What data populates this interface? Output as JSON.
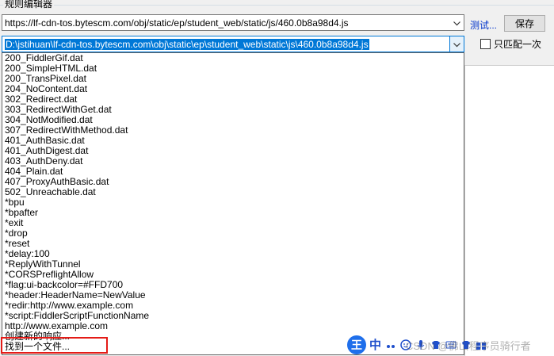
{
  "editor": {
    "group_title": "规则编辑器",
    "url_value": "https://lf-cdn-tos.bytescm.com/obj/static/ep/student_web/static/js/460.0b8a98d4.js",
    "response_value": "D:\\jstihuan\\lf-cdn-tos.bytescm.com\\obj\\static\\ep\\student_web\\static\\js\\460.0b8a98d4.js",
    "test_label": "测试...",
    "save_label": "保存",
    "match_once_label": "只匹配一次"
  },
  "dropdown_items": [
    "200_FiddlerGif.dat",
    "200_SimpleHTML.dat",
    "200_TransPixel.dat",
    "204_NoContent.dat",
    "302_Redirect.dat",
    "303_RedirectWithGet.dat",
    "304_NotModified.dat",
    "307_RedirectWithMethod.dat",
    "401_AuthBasic.dat",
    "401_AuthDigest.dat",
    "403_AuthDeny.dat",
    "404_Plain.dat",
    "407_ProxyAuthBasic.dat",
    "502_Unreachable.dat",
    "*bpu",
    "*bpafter",
    "*exit",
    "*drop",
    "*reset",
    "*delay:100",
    "*ReplyWithTunnel",
    "*CORSPreflightAllow",
    "*flag:ui-backcolor=#FFD700",
    "*header:HeaderName=NewValue",
    "*redir:http://www.example.com",
    "*script:FiddlerScriptFunctionName",
    "http://www.example.com",
    "创建新的响应...",
    "找到一个文件..."
  ],
  "tray": {
    "ime_logo": "王",
    "ime_mode": "中",
    "watermark": "CSDN @佛山程序员骑行者"
  },
  "colors": {
    "selection": "#0078d7",
    "highlight_box": "#e41b17"
  }
}
